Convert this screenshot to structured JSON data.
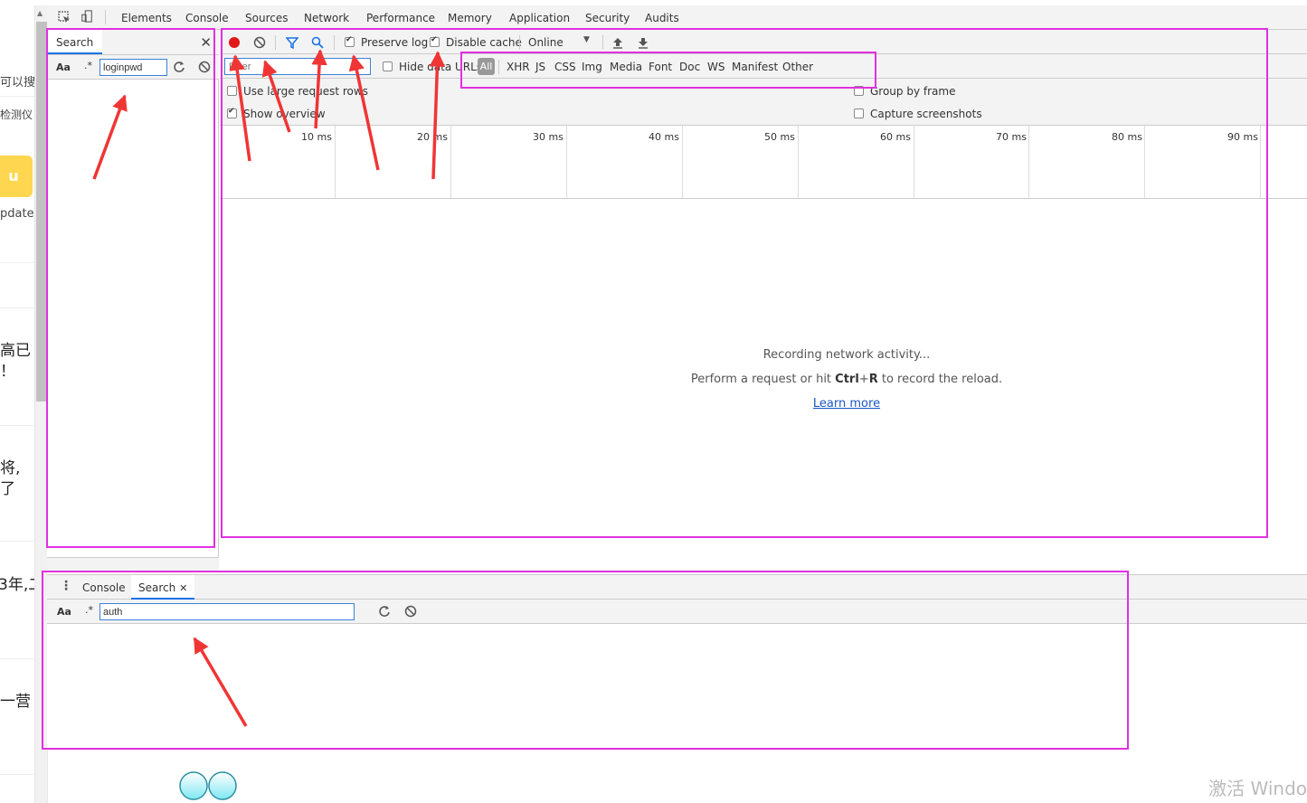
{
  "page": {
    "strip_texts": [
      "可以搜",
      "检测仪",
      "pdate",
      "高已",
      "！",
      "将,",
      "了",
      "3年,二",
      "一营"
    ],
    "strip_button_label": "u"
  },
  "devtools": {
    "tabs": [
      "Elements",
      "Console",
      "Sources",
      "Network",
      "Performance",
      "Memory",
      "Application",
      "Security",
      "Audits"
    ],
    "active_tab": "Network"
  },
  "search_panel": {
    "title": "Search",
    "case_toggle": "Aa",
    "regex_toggle": ".*",
    "query": "loginpwd"
  },
  "network": {
    "preserve_log_label": "Preserve log",
    "preserve_log_checked": true,
    "disable_cache_label": "Disable cache",
    "disable_cache_checked": true,
    "throttle_value": "Online",
    "filter_placeholder": "Filter",
    "hide_data_urls_label": "Hide data URLs",
    "type_filters": [
      "All",
      "XHR",
      "JS",
      "CSS",
      "Img",
      "Media",
      "Font",
      "Doc",
      "WS",
      "Manifest",
      "Other"
    ],
    "active_type": "All",
    "use_large_rows_label": "Use large request rows",
    "show_overview_label": "Show overview",
    "show_overview_checked": true,
    "group_by_frame_label": "Group by frame",
    "capture_screenshots_label": "Capture screenshots",
    "timeline_ticks": [
      "10 ms",
      "20 ms",
      "30 ms",
      "40 ms",
      "50 ms",
      "60 ms",
      "70 ms",
      "80 ms",
      "90 ms"
    ],
    "recording_text": "Recording network activity...",
    "reload_hint_prefix": "Perform a request or hit",
    "reload_hint_key1": "Ctrl",
    "reload_hint_plus": "+",
    "reload_hint_key2": "R",
    "reload_hint_suffix": "to record the reload.",
    "learn_more": "Learn more"
  },
  "drawer": {
    "tabs": [
      "Console",
      "Search"
    ],
    "active_tab": "Search",
    "case_toggle": "Aa",
    "regex_toggle": ".*",
    "query": "auth"
  },
  "watermark": "激活 Windo",
  "colors": {
    "highlight": "#e030e0",
    "arrow": "#f03535",
    "record": "#e01818",
    "accent": "#1a73e8"
  }
}
